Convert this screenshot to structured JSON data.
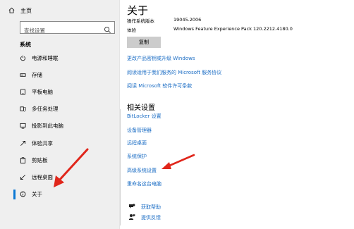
{
  "sidebar": {
    "home_label": "主页",
    "search_placeholder": "查找设置",
    "section_title": "系统",
    "items": [
      {
        "label": "电源和睡眠",
        "icon": "power-icon"
      },
      {
        "label": "存储",
        "icon": "storage-icon"
      },
      {
        "label": "平板电脑",
        "icon": "tablet-icon"
      },
      {
        "label": "多任务处理",
        "icon": "multitasking-icon"
      },
      {
        "label": "投影到此电脑",
        "icon": "project-icon"
      },
      {
        "label": "体验共享",
        "icon": "shared-experience-icon"
      },
      {
        "label": "剪贴板",
        "icon": "clipboard-icon"
      },
      {
        "label": "远程桌面",
        "icon": "remote-desktop-icon"
      },
      {
        "label": "关于",
        "icon": "info-icon",
        "active": true
      }
    ]
  },
  "main": {
    "title": "关于",
    "specs": [
      {
        "label": "操作系统版本",
        "value": "19045.2006"
      },
      {
        "label": "体验",
        "value": "Windows Feature Experience Pack 120.2212.4180.0"
      }
    ],
    "copy_button": "复制",
    "top_links": [
      "更改产品密钥或升级 Windows",
      "阅读适用于我们服务的 Microsoft 服务协议",
      "阅读 Microsoft 软件许可条款"
    ],
    "related_title": "相关设置",
    "related_links": [
      "BitLocker 设置",
      "设备管理器",
      "远程桌面",
      "系统保护",
      "高级系统设置",
      "重命名这台电脑"
    ],
    "footer_links": [
      {
        "label": "获取帮助",
        "icon": "help-icon"
      },
      {
        "label": "提供反馈",
        "icon": "feedback-icon"
      }
    ]
  },
  "colors": {
    "accent": "#0a78d4",
    "link": "#1a6cc4",
    "arrow": "#e0261b",
    "sidebar_bg": "#efefef"
  }
}
